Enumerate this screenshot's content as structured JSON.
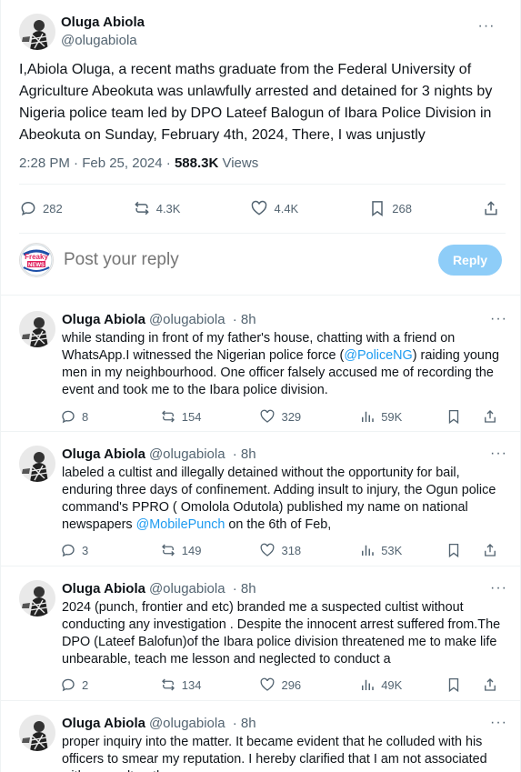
{
  "main": {
    "author_name": "Oluga Abiola",
    "author_handle": "@olugabiola",
    "text": "I,Abiola Oluga, a recent maths graduate from the Federal University of Agriculture Abeokuta was unlawfully arrested and detained for 3 nights by Nigeria police team led by DPO Lateef Balogun of Ibara Police Division in Abeokuta on Sunday, February 4th, 2024, There, I was unjustly",
    "time": "2:28 PM · Feb 25, 2024 · ",
    "views": "588.3K",
    "views_label": " Views",
    "replies": "282",
    "reposts": "4.3K",
    "likes": "4.4K",
    "bookmarks": "268"
  },
  "composer": {
    "placeholder": "Post your reply",
    "reply_label": "Reply",
    "logo_text": "Freaky News"
  },
  "replies": [
    {
      "name": "Oluga Abiola",
      "handle": "@olugabiola",
      "age": " · 8h",
      "text_before": "while standing in front of my father's house, chatting with a friend on WhatsApp.I witnessed the Nigerian police force (",
      "mention": "@PoliceNG",
      "text_after": ") raiding young men in my neighbourhood. One officer falsely accused me of recording the event and took me to the Ibara police division.",
      "replies": "8",
      "reposts": "154",
      "likes": "329",
      "views": "59K"
    },
    {
      "name": "Oluga Abiola",
      "handle": "@olugabiola",
      "age": " · 8h",
      "text_before": "labeled a cultist and illegally detained without the opportunity for bail, enduring three days of confinement. Adding insult to injury, the Ogun police command's PPRO ( Omolola Odutola) published my name on national newspapers ",
      "mention": "@MobilePunch",
      "text_after": " on the 6th of Feb,",
      "replies": "3",
      "reposts": "149",
      "likes": "318",
      "views": "53K"
    },
    {
      "name": "Oluga Abiola",
      "handle": "@olugabiola",
      "age": " · 8h",
      "text_before": "2024 (punch, frontier and etc) branded me a suspected cultist without conducting any investigation . Despite the innocent arrest suffered from.The DPO (Lateef Balofun)of the Ibara police division threatened me to make life unbearable, teach me lesson and neglected to conduct a",
      "mention": "",
      "text_after": "",
      "replies": "2",
      "reposts": "134",
      "likes": "296",
      "views": "49K"
    },
    {
      "name": "Oluga Abiola",
      "handle": "@olugabiola",
      "age": " · 8h",
      "text_before": "proper inquiry into the matter. It became evident that he colluded with his officers to smear my reputation. I hereby clarified that I am not associated with any cult or thug.",
      "mention": "",
      "text_after": "",
      "replies": "",
      "reposts": "",
      "likes": "",
      "views": ""
    }
  ],
  "icons": {
    "more": "more-horizontal-icon",
    "reply": "reply-bubble-icon",
    "repost": "repost-icon",
    "like": "heart-icon",
    "views": "views-bar-chart-icon",
    "bookmark": "bookmark-icon",
    "share": "share-icon"
  },
  "colors": {
    "accent": "#1d9bf0",
    "reply_button": "#8ecdf8",
    "muted": "#536471",
    "text": "#0f1419"
  }
}
